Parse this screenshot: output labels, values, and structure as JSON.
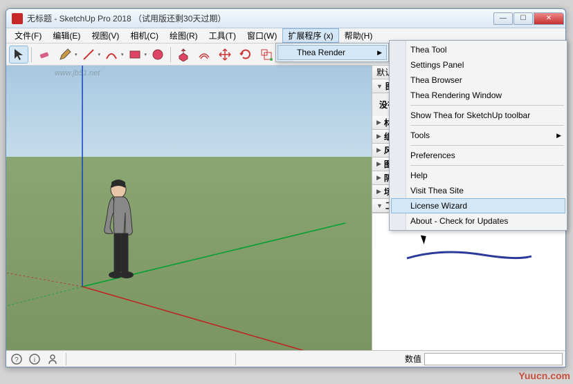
{
  "title": "无标题 - SketchUp Pro 2018 （试用版还剩30天过期）",
  "menubar": [
    "文件(F)",
    "编辑(E)",
    "视图(V)",
    "相机(C)",
    "绘图(R)",
    "工具(T)",
    "窗口(W)",
    "扩展程序 (x)",
    "帮助(H)"
  ],
  "active_menu_index": 7,
  "toolbar_icons": [
    "select",
    "eraser",
    "pencil",
    "line",
    "arc",
    "rectangle",
    "circle",
    "pushpull",
    "offset",
    "move",
    "rotate",
    "scale",
    "tape",
    "paint",
    "orbit",
    "pan",
    "zoom",
    "zoom-extents"
  ],
  "side_panel": {
    "header": "默认面板",
    "entity_info": "图元信",
    "no_selection": "没有选择",
    "sections": [
      "材料",
      "组件",
      "风格",
      "图层",
      "阴影",
      "场景",
      "工具向导"
    ]
  },
  "statusbar": {
    "value_label": "数值"
  },
  "ctx1": {
    "label": "Thea Render"
  },
  "ctx2": {
    "items": [
      {
        "label": "Thea Tool"
      },
      {
        "label": "Settings Panel"
      },
      {
        "label": "Thea Browser"
      },
      {
        "label": "Thea Rendering Window"
      },
      {
        "sep": true
      },
      {
        "label": "Show Thea for SketchUp toolbar"
      },
      {
        "sep": true
      },
      {
        "label": "Tools",
        "sub": true
      },
      {
        "sep": true
      },
      {
        "label": "Preferences"
      },
      {
        "sep": true
      },
      {
        "label": "Help"
      },
      {
        "label": "Visit Thea Site"
      },
      {
        "label": "License Wizard",
        "hi": true
      },
      {
        "label": "About - Check for Updates"
      }
    ]
  },
  "watermarks": [
    "www.jb51.net",
    "www.jb51.net",
    "Yuucn.com"
  ]
}
